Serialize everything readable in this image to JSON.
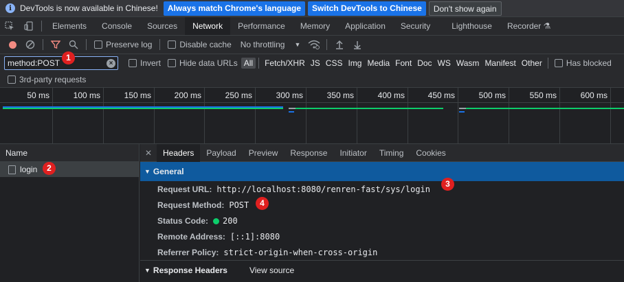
{
  "infobar": {
    "message": "DevTools is now available in Chinese!",
    "btn_match": "Always match Chrome's language",
    "btn_switch": "Switch DevTools to Chinese",
    "btn_dismiss": "Don't show again"
  },
  "tabs": [
    "Elements",
    "Console",
    "Sources",
    "Network",
    "Performance",
    "Memory",
    "Application",
    "Security",
    "Lighthouse",
    "Recorder ⚗"
  ],
  "toolbar": {
    "preserve_log": "Preserve log",
    "disable_cache": "Disable cache",
    "throttling": "No throttling"
  },
  "filter": {
    "value": "method:POST",
    "invert": "Invert",
    "hide_data_urls": "Hide data URLs",
    "types": [
      "All",
      "Fetch/XHR",
      "JS",
      "CSS",
      "Img",
      "Media",
      "Font",
      "Doc",
      "WS",
      "Wasm",
      "Manifest",
      "Other"
    ],
    "has_blocked": "Has blocked",
    "third_party": "3rd-party requests"
  },
  "timeline": {
    "labels": [
      "50 ms",
      "100 ms",
      "150 ms",
      "200 ms",
      "250 ms",
      "300 ms",
      "350 ms",
      "400 ms",
      "450 ms",
      "500 ms",
      "550 ms",
      "600 ms"
    ]
  },
  "requests": {
    "header": "Name",
    "items": [
      "login"
    ]
  },
  "detail_tabs": [
    "Headers",
    "Payload",
    "Preview",
    "Response",
    "Initiator",
    "Timing",
    "Cookies"
  ],
  "general": {
    "title": "General",
    "request_url_label": "Request URL:",
    "request_url": "http://localhost:8080/renren-fast/sys/login",
    "method_label": "Request Method:",
    "method": "POST",
    "status_label": "Status Code:",
    "status": "200",
    "remote_label": "Remote Address:",
    "remote": "[::1]:8080",
    "referrer_label": "Referrer Policy:",
    "referrer": "strict-origin-when-cross-origin"
  },
  "response_headers": {
    "title": "Response Headers",
    "view_source": "View source"
  },
  "badges": [
    "1",
    "2",
    "3",
    "4"
  ],
  "colors": {
    "accent_blue": "#1a73e8",
    "selected_row": "#0f5a9e",
    "status_green": "#0cce6b",
    "badge_red": "#e02020"
  }
}
